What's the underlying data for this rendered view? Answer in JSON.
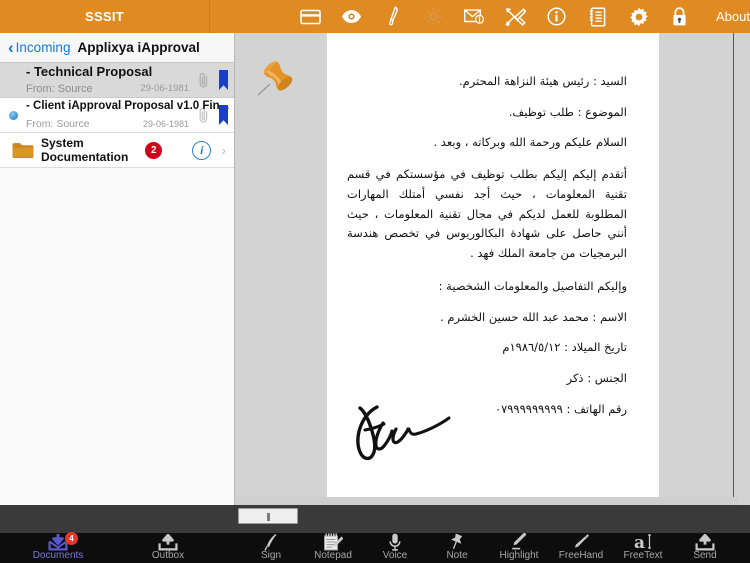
{
  "topbar": {
    "app_title": "SSSIT",
    "about_label": "About",
    "bg_color": "#e08b22",
    "icons": [
      {
        "name": "card-icon"
      },
      {
        "name": "eye-icon"
      },
      {
        "name": "brush-icon"
      },
      {
        "name": "gear-outline-icon"
      },
      {
        "name": "mail-icon"
      },
      {
        "name": "tools-icon"
      },
      {
        "name": "info-icon"
      },
      {
        "name": "list-document-icon"
      },
      {
        "name": "settings-gear-icon"
      },
      {
        "name": "lock-icon"
      }
    ]
  },
  "sidebar": {
    "back_chevron": "‹",
    "back_label": "Incoming",
    "title": "Applixya iApproval",
    "rows": [
      {
        "title": "- Technical Proposal",
        "subtitle": "From: Source",
        "date": "29-06-1981",
        "selected": true,
        "unread": false,
        "flagged": true,
        "attachment": true
      },
      {
        "title": "- Client iApproval Proposal v1.0 Fin...",
        "subtitle": "From: Source",
        "date": "29-06-1981",
        "selected": false,
        "unread": true,
        "flagged": true,
        "attachment": true
      }
    ],
    "folder": {
      "name": "System Documentation",
      "badge": "2",
      "info_glyph": "i",
      "disclosure": "›"
    }
  },
  "document": {
    "pin_icon": "pushpin-icon",
    "lines": [
      "السيد : رئيس هيئة النزاهة المحترم.",
      "الموضوع : طلب توظيف.",
      "السلام عليكم ورحمة الله وبركاته ، وبعد ."
    ],
    "paragraph": "أتقدم إليكم إليكم بطلب توظيف في مؤسستكم في قسم تقنية المعلومات ، حيث أجد نفسي أمتلك المهارات المطلوبة للعمل لديكم في مجال تقنية المعلومات ، حيث أنني حاصل على شهادة البكالوريوس في تخصص هندسة البرمجيات من جامعة الملك فهد .",
    "details_intro": "وإليكم التفاصيل والمعلومات الشخصية :",
    "fields": [
      "الاسم : محمد عبد الله حسين الخشرم .",
      "تاريخ الميلاد : ١٩٨٦/٥/١٢م",
      "الجنس : ذكر",
      "رقم الهاتف : ٠٧٩٩٩٩٩٩٩٩٩"
    ],
    "signature": "signature-mark"
  },
  "bottom_toolbar": {
    "left_items": [
      {
        "label": "Documents",
        "icon": "download-inbox-icon",
        "badge": "4",
        "active": true
      },
      {
        "label": "Outbox",
        "icon": "upload-outbox-icon",
        "badge": "",
        "active": false
      }
    ],
    "right_items": [
      {
        "label": "Sign",
        "icon": "quill-pen-icon"
      },
      {
        "label": "Notepad",
        "icon": "notepad-icon"
      },
      {
        "label": "Voice",
        "icon": "microphone-icon"
      },
      {
        "label": "Note",
        "icon": "pushpin-note-icon"
      },
      {
        "label": "Highlight",
        "icon": "highlighter-icon"
      },
      {
        "label": "FreeHand",
        "icon": "pencil-icon"
      },
      {
        "label": "FreeText",
        "icon": "text-cursor-icon"
      },
      {
        "label": "Send",
        "icon": "send-up-arrow-icon"
      }
    ]
  }
}
